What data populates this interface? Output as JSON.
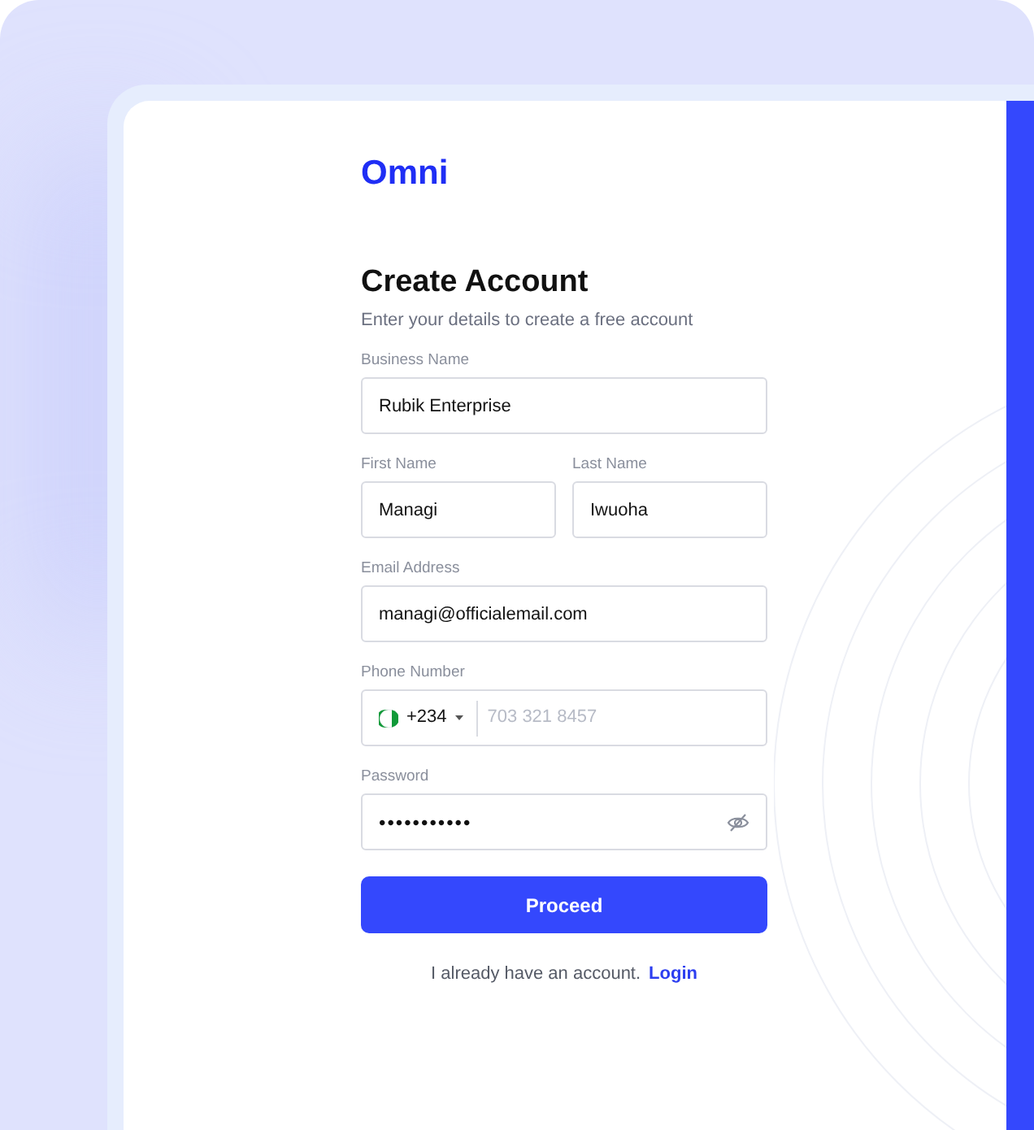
{
  "logo": "Omni",
  "heading": "Create Account",
  "subheading": "Enter your details to create a free account",
  "rows": [
    {
      "fields": [
        {
          "kind": "text",
          "label": "Business Name",
          "value": "Rubik Enterprise"
        }
      ]
    },
    {
      "fields": [
        {
          "kind": "text",
          "label": "First Name",
          "value": "Managi"
        },
        {
          "kind": "text",
          "label": "Last Name",
          "value": "Iwuoha"
        }
      ]
    },
    {
      "fields": [
        {
          "kind": "text",
          "label": "Email Address",
          "value": "managi@officialemail.com"
        }
      ]
    },
    {
      "fields": [
        {
          "kind": "phone",
          "label": "Phone Number",
          "country_code": "+234",
          "placeholder": "703 321 8457"
        }
      ]
    },
    {
      "fields": [
        {
          "kind": "password",
          "label": "Password",
          "value": "•••••••••••"
        }
      ]
    }
  ],
  "submit_button": "Proceed",
  "footer": {
    "text": "I already have an account.",
    "link": "Login"
  }
}
